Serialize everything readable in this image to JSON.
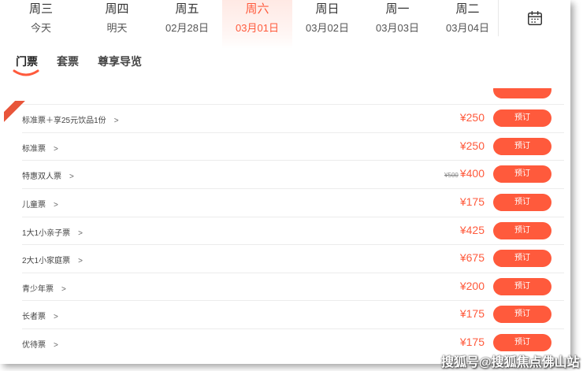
{
  "date_bar": {
    "days": [
      {
        "dow": "周三",
        "date": "今天"
      },
      {
        "dow": "周四",
        "date": "明天"
      },
      {
        "dow": "周五",
        "date": "02月28日"
      },
      {
        "dow": "周六",
        "date": "03月01日"
      },
      {
        "dow": "周日",
        "date": "03月02日"
      },
      {
        "dow": "周一",
        "date": "03月03日"
      },
      {
        "dow": "周二",
        "date": "03月04日"
      }
    ],
    "active_index": 3,
    "calendar_icon": "calendar-icon"
  },
  "tabs": [
    {
      "label": "门票",
      "active": true
    },
    {
      "label": "套票",
      "active": false
    },
    {
      "label": "尊享导览",
      "active": false
    }
  ],
  "tickets": [
    {
      "name": "标准票＋享25元饮品1份",
      "price": "¥250",
      "old_price": "",
      "button": "预订"
    },
    {
      "name": "标准票",
      "price": "¥250",
      "old_price": "",
      "button": "预订"
    },
    {
      "name": "特惠双人票",
      "price": "¥400",
      "old_price": "¥500",
      "button": "预订"
    },
    {
      "name": "儿童票",
      "price": "¥175",
      "old_price": "",
      "button": "预订"
    },
    {
      "name": "1大1小亲子票",
      "price": "¥425",
      "old_price": "",
      "button": "预订"
    },
    {
      "name": "2大1小家庭票",
      "price": "¥675",
      "old_price": "",
      "button": "预订"
    },
    {
      "name": "青少年票",
      "price": "¥200",
      "old_price": "",
      "button": "预订"
    },
    {
      "name": "长者票",
      "price": "¥175",
      "old_price": "",
      "button": "预订"
    },
    {
      "name": "优待票",
      "price": "¥175",
      "old_price": "",
      "button": "预订"
    }
  ],
  "arrow_glyph": ">",
  "accent_color": "#ff5a3c",
  "watermark": "搜狐号@搜狐焦点佛山站"
}
